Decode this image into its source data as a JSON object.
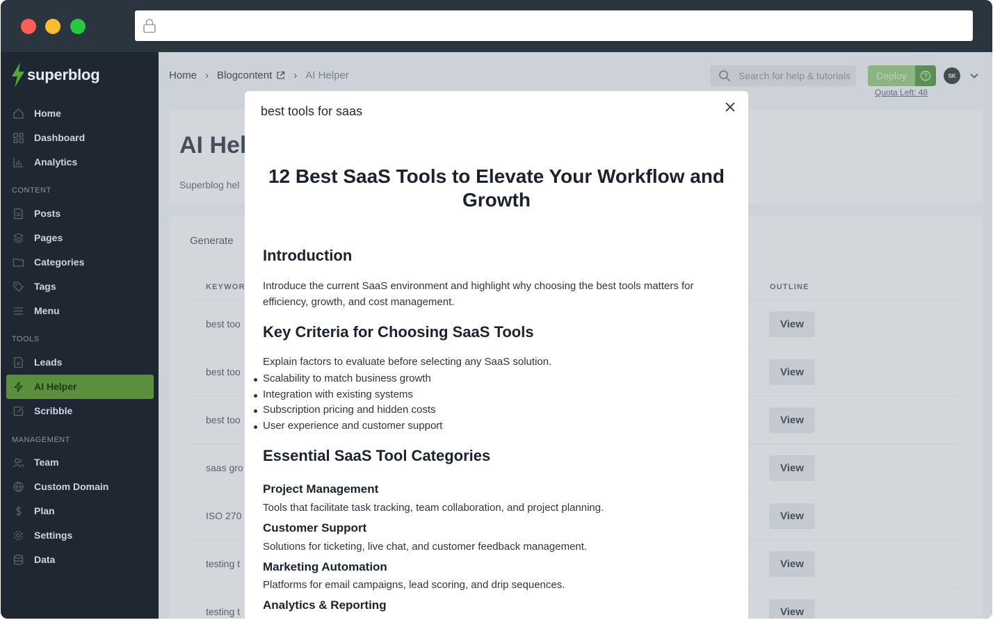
{
  "sidebar": {
    "logo": "superblog",
    "items_top": [
      {
        "label": "Home",
        "icon": "home-icon"
      },
      {
        "label": "Dashboard",
        "icon": "dashboard-icon"
      },
      {
        "label": "Analytics",
        "icon": "analytics-icon"
      }
    ],
    "section_content": "CONTENT",
    "items_content": [
      {
        "label": "Posts",
        "icon": "posts-icon"
      },
      {
        "label": "Pages",
        "icon": "pages-icon"
      },
      {
        "label": "Categories",
        "icon": "folder-icon"
      },
      {
        "label": "Tags",
        "icon": "tag-icon"
      },
      {
        "label": "Menu",
        "icon": "menu-icon"
      }
    ],
    "section_tools": "TOOLS",
    "items_tools": [
      {
        "label": "Leads",
        "icon": "leads-icon"
      },
      {
        "label": "AI Helper",
        "icon": "bolt-icon",
        "active": true
      },
      {
        "label": "Scribble",
        "icon": "scribble-icon"
      }
    ],
    "section_management": "MANAGEMENT",
    "items_management": [
      {
        "label": "Team",
        "icon": "team-icon"
      },
      {
        "label": "Custom Domain",
        "icon": "globe-icon"
      },
      {
        "label": "Plan",
        "icon": "dollar-icon"
      },
      {
        "label": "Settings",
        "icon": "gear-icon"
      },
      {
        "label": "Data",
        "icon": "database-icon"
      }
    ]
  },
  "breadcrumb": {
    "home": "Home",
    "blog": "Blogcontent",
    "current": "AI Helper"
  },
  "header": {
    "search_placeholder": "Search for help & tutorials",
    "deploy_label": "Deploy",
    "quota": "Quota Left: 48",
    "avatar_initials": "SK"
  },
  "page": {
    "title": "AI Hel",
    "subtitle": "Superblog hel",
    "generate_tab": "Generate",
    "col_keyword": "KEYWORI",
    "col_outline": "OUTLINE",
    "rows": [
      {
        "keyword": "best too",
        "action": "View"
      },
      {
        "keyword": "best too",
        "action": "View"
      },
      {
        "keyword": "best too",
        "action": "View"
      },
      {
        "keyword": "saas gro",
        "action": "View"
      },
      {
        "keyword": "ISO 270",
        "action": "View"
      },
      {
        "keyword": "testing t",
        "action": "View"
      },
      {
        "keyword": "testing t",
        "action": "View"
      }
    ]
  },
  "modal": {
    "title": "best tools for saas",
    "article": {
      "h1": "12 Best SaaS Tools to Elevate Your Workflow and Growth",
      "intro_heading": "Introduction",
      "intro_text": "Introduce the current SaaS environment and highlight why choosing the best tools matters for efficiency, growth, and cost management.",
      "criteria_heading": "Key Criteria for Choosing SaaS Tools",
      "criteria_text": "Explain factors to evaluate before selecting any SaaS solution.",
      "criteria_items": [
        "Scalability to match business growth",
        "Integration with existing systems",
        "Subscription pricing and hidden costs",
        "User experience and customer support"
      ],
      "categories_heading": "Essential SaaS Tool Categories",
      "categories": [
        {
          "name": "Project Management",
          "desc": "Tools that facilitate task tracking, team collaboration, and project planning."
        },
        {
          "name": "Customer Support",
          "desc": "Solutions for ticketing, live chat, and customer feedback management."
        },
        {
          "name": "Marketing Automation",
          "desc": "Platforms for email campaigns, lead scoring, and drip sequences."
        },
        {
          "name": "Analytics & Reporting",
          "desc": ""
        }
      ]
    }
  }
}
